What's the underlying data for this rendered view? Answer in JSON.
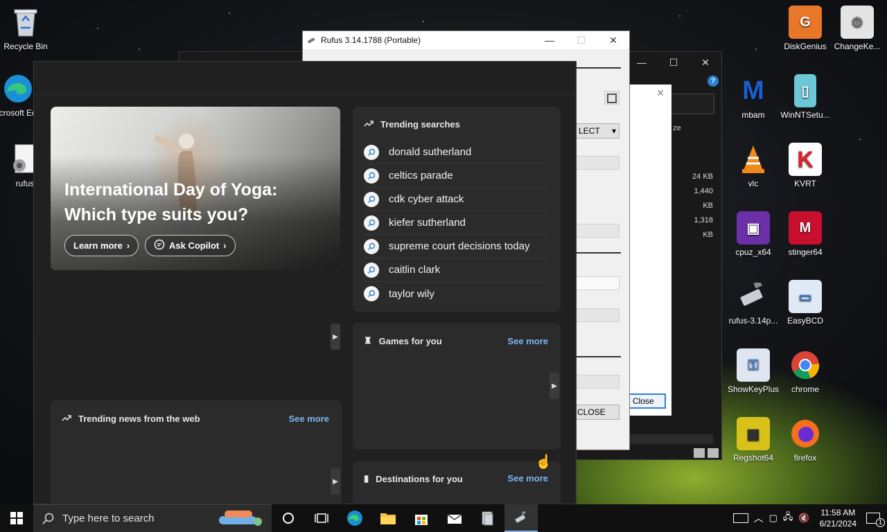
{
  "desktop": {
    "left_icons": [
      {
        "label": "Recycle Bin",
        "icon": "recycle-bin-icon"
      },
      {
        "label": "Microsoft Edge",
        "icon": "edge-icon"
      },
      {
        "label": "rufus",
        "icon": "rufus-icon"
      }
    ],
    "right_icons": [
      {
        "label": "DiskGenius",
        "icon": "diskgenius-icon",
        "color": "#e8772a"
      },
      {
        "label": "ChangeKe...",
        "icon": "changekey-icon",
        "color": "#c8c8c8"
      },
      {
        "label": "mbam",
        "icon": "malwarebytes-icon",
        "color": "#1d5fd1"
      },
      {
        "label": "WinNTSetu...",
        "icon": "winntsetup-icon",
        "color": "#6cc7d6"
      },
      {
        "label": "vlc",
        "icon": "vlc-icon",
        "color": "#f08a1c"
      },
      {
        "label": "KVRT",
        "icon": "kvrt-icon",
        "color": "#e0202a"
      },
      {
        "label": "cpuz_x64",
        "icon": "cpuz-icon",
        "color": "#6b2fa8"
      },
      {
        "label": "stinger64",
        "icon": "stinger-icon",
        "color": "#c8102e"
      },
      {
        "label": "rufus-3.14p...",
        "icon": "usb-drive-icon",
        "color": "#9aa3ad"
      },
      {
        "label": "EasyBCD",
        "icon": "easybcd-icon",
        "color": "#3a7bd5"
      },
      {
        "label": "ShowKeyPlus",
        "icon": "showkeyplus-icon",
        "color": "#5a8fd8"
      },
      {
        "label": "chrome",
        "icon": "chrome-icon",
        "color": "#2a9d4a"
      },
      {
        "label": "Regshot64",
        "icon": "regshot-icon",
        "color": "#d8c21a"
      },
      {
        "label": "firefox",
        "icon": "firefox-icon",
        "color": "#f2701e"
      }
    ]
  },
  "explorer": {
    "size_header": "ze",
    "sizes": [
      "24 KB",
      "1,440 KB",
      "1,318 KB"
    ],
    "help": "?"
  },
  "dialog": {
    "close_label": "Close"
  },
  "rufus": {
    "title": "Rufus 3.14.1788 (Portable)",
    "select_label": "LECT",
    "close_label": "CLOSE"
  },
  "widgets": {
    "hero": {
      "title": "International Day of Yoga: Which type suits you?",
      "learn_more": "Learn more",
      "ask_copilot": "Ask Copilot"
    },
    "trending_searches": {
      "title": "Trending searches",
      "items": [
        "donald sutherland",
        "celtics parade",
        "cdk cyber attack",
        "kiefer sutherland",
        "supreme court decisions today",
        "caitlin clark",
        "taylor wily"
      ]
    },
    "games": {
      "title": "Games for you",
      "see_more": "See more"
    },
    "news": {
      "title": "Trending news from the web",
      "see_more": "See more"
    },
    "destinations": {
      "title": "Destinations for you",
      "see_more": "See more"
    }
  },
  "taskbar": {
    "search_placeholder": "Type here to search",
    "time": "11:58 AM",
    "date": "6/21/2024",
    "notification_count": "1"
  }
}
